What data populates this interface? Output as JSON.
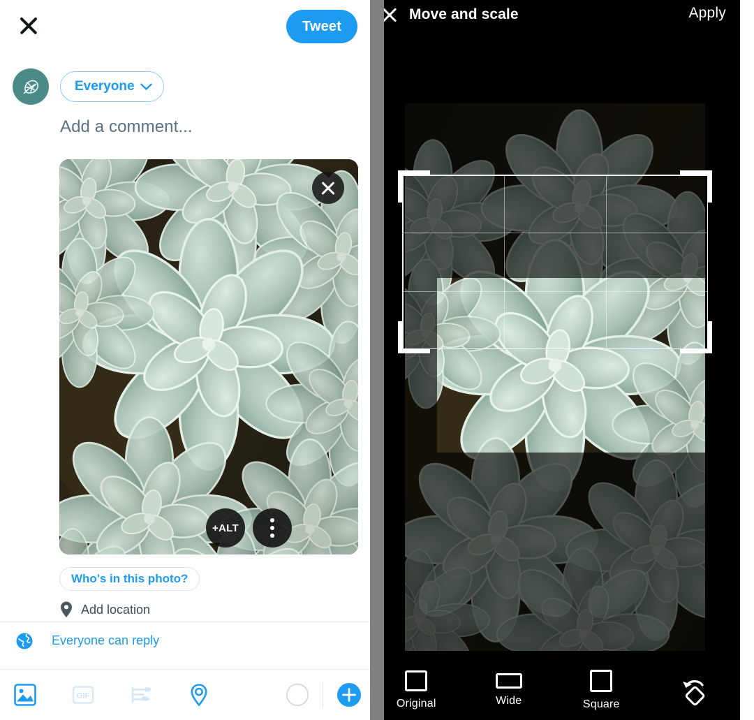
{
  "compose": {
    "close_icon": "close-icon",
    "tweet_button": "Tweet",
    "avatar_icon": "leaf-avatar-icon",
    "audience": {
      "label": "Everyone",
      "chevron_icon": "chevron-down-icon"
    },
    "comment_placeholder": "Add a comment...",
    "photo": {
      "alt_badge": "+ALT",
      "more_icon": "more-vertical-icon",
      "remove_icon": "close-icon"
    },
    "whos_in_photo": "Who's in this photo?",
    "add_location": {
      "label": "Add location",
      "icon": "location-pin-icon"
    },
    "reply_setting": {
      "label": "Everyone can reply",
      "icon": "globe-icon"
    },
    "toolbar": [
      {
        "name": "media-icon",
        "label": "Media",
        "state": "active"
      },
      {
        "name": "gif-icon",
        "label": "GIF",
        "state": "disabled"
      },
      {
        "name": "poll-icon",
        "label": "Poll",
        "state": "disabled"
      },
      {
        "name": "location-icon",
        "label": "Location",
        "state": "active"
      },
      {
        "name": "progress-ring-icon",
        "label": "Character count",
        "state": "empty"
      },
      {
        "name": "add-tweet-icon",
        "label": "Add tweet",
        "state": "active"
      }
    ]
  },
  "cropper": {
    "close_icon": "close-icon",
    "title": "Move and scale",
    "apply_button": "Apply",
    "ratios": [
      {
        "label": "Original",
        "icon": "rect-original-icon"
      },
      {
        "label": "Wide",
        "icon": "rect-wide-icon"
      },
      {
        "label": "Square",
        "icon": "rect-square-icon"
      }
    ],
    "rotate_icon": "rotate-icon"
  },
  "colors": {
    "accent_blue": "#1d9bf0",
    "text_dark": "#14171a",
    "text_muted": "#5b7083",
    "avatar_teal": "#4a8a87",
    "panel_black": "#000000",
    "scrollbar_gray": "#808080"
  }
}
